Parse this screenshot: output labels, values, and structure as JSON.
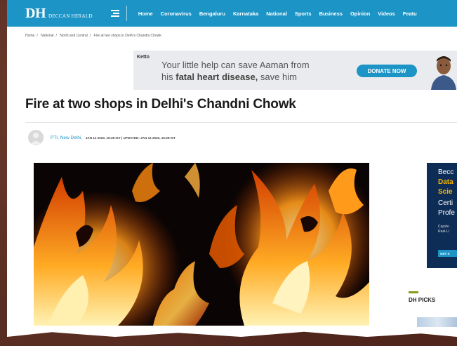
{
  "header": {
    "logo_main": "DH",
    "logo_sub": "DECCAN HERALD",
    "nav": [
      "Home",
      "Coronavirus",
      "Bengaluru",
      "Karnataka",
      "National",
      "Sports",
      "Business",
      "Opinion",
      "Videos",
      "Featu"
    ]
  },
  "breadcrumb": [
    "Home",
    "National",
    "North and Central",
    "Fire at two shops in Delhi's Chandni Chowk"
  ],
  "ad": {
    "brand": "Ketto",
    "line1": "Your little help can save Aaman from",
    "line2_prefix": "his ",
    "line2_bold": "fatal heart disease,",
    "line2_suffix": " save him",
    "cta": "DONATE NOW"
  },
  "article": {
    "title": "Fire at two shops in Delhi's Chandni Chowk",
    "author": "PTI, New Delhi,",
    "meta": "JAN 12 2020, 16:28 IST  |  UPDATED: JAN 12 2020, 16:28 IST"
  },
  "side_ad": {
    "line1": "Becc",
    "line2": "Data",
    "line3": "Scie",
    "line4": "Certi",
    "line5": "Profe",
    "line6": "Capsto",
    "line7": "Real-Li",
    "cta": "GET S"
  },
  "dh_picks": {
    "title": "DH PICKS"
  },
  "colors": {
    "brand_blue": "#1c94c6",
    "ad_navy": "#0d2d57",
    "ad_gold": "#f5b400",
    "picks_accent": "#8a9a1a",
    "backdrop": "#5a2d22"
  }
}
